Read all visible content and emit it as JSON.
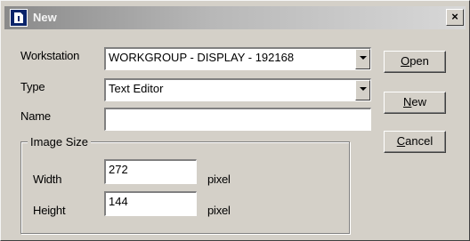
{
  "window": {
    "title": "New",
    "close_label": "×"
  },
  "form": {
    "workstation_label": "Workstation",
    "workstation_value": "WORKGROUP - DISPLAY - 192168",
    "type_label": "Type",
    "type_value": "Text Editor",
    "name_label": "Name",
    "name_value": ""
  },
  "image_size": {
    "group_label": "Image Size",
    "width_label": "Width",
    "width_value": "272",
    "width_unit": "pixel",
    "height_label": "Height",
    "height_value": "144",
    "height_unit": "pixel"
  },
  "buttons": {
    "open": {
      "mnemonic": "O",
      "rest": "pen"
    },
    "new": {
      "mnemonic": "N",
      "rest": "ew"
    },
    "cancel": {
      "mnemonic": "C",
      "rest": "ancel"
    }
  },
  "icons": [
    "window-icon",
    "close-icon",
    "dropdown-arrow-icon"
  ]
}
